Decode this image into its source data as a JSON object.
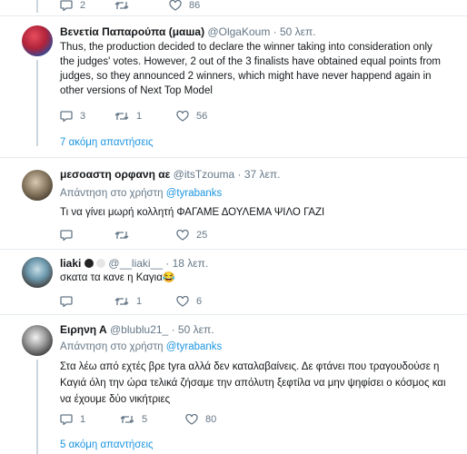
{
  "top_actions": {
    "replies": "2",
    "retweets": "",
    "likes": "86"
  },
  "tweets": [
    {
      "name": "Βενετία Παπαρούπα (μαша)",
      "handle": "@OlgaKoum",
      "time": "· 50 λεπ.",
      "reply_label": "",
      "reply_handle": "",
      "text": "Thus, the production decided to declare the winner taking into consideration only the judges' votes. However, 2 out of the 3 finalists have obtained equal points from judges, so they announced 2 winners, which might have never happend again in other versions of Next Top Model",
      "replies": "3",
      "retweets": "1",
      "likes": "56",
      "more": "7 ακόμη απαντήσεις"
    },
    {
      "name": "μεσοαστη ορφανη αε",
      "handle": "@itsTzouma",
      "time": "· 37 λεπ.",
      "reply_label": "Απάντηση στο χρήστη",
      "reply_handle": "@tyrabanks",
      "text": "Τι να γίνει μωρή κολλητή ΦΑΓΑΜΕ ΔΟΥΛΕΜΑ ΨΙΛΟ ΓΑΖΙ",
      "replies": "",
      "retweets": "",
      "likes": "25",
      "more": ""
    },
    {
      "name": "liaki",
      "handle": "@__liaki__",
      "time": "· 18 λεπ.",
      "reply_label": "",
      "reply_handle": "",
      "text": "σκατα τα κανε η Καγια😂",
      "replies": "",
      "retweets": "1",
      "likes": "6",
      "more": ""
    },
    {
      "name": "Ειρηνη Α",
      "handle": "@blublu21_",
      "time": "· 50 λεπ.",
      "reply_label": "Απάντηση στο χρήστη",
      "reply_handle": "@tyrabanks",
      "text": "Στα λέω από εχτές βρε tyra αλλά δεν καταλαβαίνεις. Δε φτάνει που τραγουδούσε η Καγιά όλη την ώρα τελικά ζήσαμε την απόλυτη ξεφτίλα να μην ψηφίσει ο κόσμος και να έχουμε δύο νικήτριες",
      "replies": "1",
      "retweets": "5",
      "likes": "80",
      "more": "5 ακόμη απαντήσεις"
    }
  ],
  "icons": {
    "reply": "reply-icon",
    "retweet": "retweet-icon",
    "like": "heart-icon"
  },
  "colors": {
    "link": "#1b95e0",
    "muted": "#657786",
    "divider": "#e6ecf0"
  }
}
